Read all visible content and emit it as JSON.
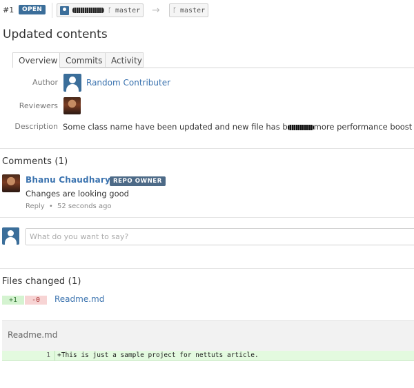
{
  "header": {
    "pr_number": "#1",
    "status": "OPEN",
    "source_branch_icon": "branch-icon",
    "source_branch": "master",
    "target_branch": "master"
  },
  "title": "Updated contents",
  "tabs": [
    {
      "label": "Overview",
      "active": true
    },
    {
      "label": "Commits",
      "active": false
    },
    {
      "label": "Activity",
      "active": false
    }
  ],
  "meta": {
    "author_label": "Author",
    "author_name": "Random Contributer",
    "reviewers_label": "Reviewers",
    "description_label": "Description",
    "description_before": "Some class name have been updated and new file has b",
    "description_after": "more performance boost"
  },
  "comments": {
    "title": "Comments (1)",
    "items": [
      {
        "author": "Bhanu Chaudhary",
        "badge": "REPO OWNER",
        "body": "Changes are looking good",
        "reply_label": "Reply",
        "separator": "•",
        "time": "52 seconds ago"
      }
    ],
    "input_placeholder": "What do you want to say?"
  },
  "files": {
    "title": "Files changed (1)",
    "additions": "+1",
    "deletions": "-0",
    "file_name": "Readme.md",
    "diff": {
      "header": "Readme.md",
      "line_number": "1",
      "line_text": "+This is just a sample project for nettuts article."
    }
  },
  "colors": {
    "accent": "#3b6e9a",
    "link": "#3b73af",
    "added_bg": "#d4f3d0",
    "removed_bg": "#f7d4d4"
  }
}
